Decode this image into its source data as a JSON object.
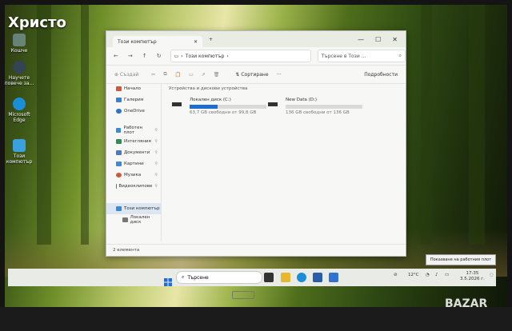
{
  "overlay": {
    "user_name": "Христо"
  },
  "desktop": {
    "icons": [
      {
        "label": "Кошче"
      },
      {
        "label": "Научете повече за..."
      },
      {
        "label": "Microsoft Edge"
      },
      {
        "label": "Този компютър"
      }
    ]
  },
  "explorer": {
    "tab_title": "Този компютър",
    "tab_close": "✕",
    "new_tab": "+",
    "window_buttons": {
      "minimize": "—",
      "maximize": "☐",
      "close": "✕"
    },
    "nav": {
      "back": "←",
      "forward": "→",
      "up": "↑",
      "refresh": "↻"
    },
    "address": {
      "pc_icon": "▭",
      "chevron": "›",
      "path": "Този компютър",
      "after": "›"
    },
    "search_placeholder": "Търсене в Този ...",
    "toolbar": {
      "new": "⊕ Създай",
      "cut": "✂",
      "copy": "⧉",
      "paste": "📋",
      "rename": "▭",
      "share": "↗",
      "delete": "🗑",
      "sort": "⇅ Сортиране",
      "more": "···",
      "details": "Подробности"
    },
    "sidebar": [
      {
        "label": "Начало",
        "color": "#d0573c"
      },
      {
        "label": "Галерия",
        "color": "#3c7fd0"
      },
      {
        "label": "OneDrive",
        "color": "#2f72d0"
      },
      {
        "label": "Работен плот",
        "color": "#3b8ad6"
      },
      {
        "label": "Изтегляния",
        "color": "#2f8b57"
      },
      {
        "label": "Документи",
        "color": "#4e77c8"
      },
      {
        "label": "Картини",
        "color": "#3b8ad6"
      },
      {
        "label": "Музика",
        "color": "#d0573c"
      },
      {
        "label": "Видеоклипове",
        "color": "#8a4fc2"
      },
      {
        "label": "Този компютър",
        "color": "#3b8ad6"
      },
      {
        "label": "Локален диск",
        "color": "#777"
      }
    ],
    "section_header": "Устройства и дискови устройства",
    "drives": [
      {
        "name": "Локален диск (C:)",
        "free": "63,7 GB свободни от 99,8 GB",
        "used_fraction": 0.36
      },
      {
        "name": "New Data (D:)",
        "free": "136 GB свободни от 136 GB",
        "used_fraction": 0.0
      }
    ],
    "status": "2 елемента"
  },
  "taskbar": {
    "search": "Търсене",
    "weather": "12°C",
    "time": "17:35",
    "date": "3.5.2026 г.",
    "lang": "BG"
  },
  "toast": "Показване на работния плот",
  "watermark": "BAZAR"
}
